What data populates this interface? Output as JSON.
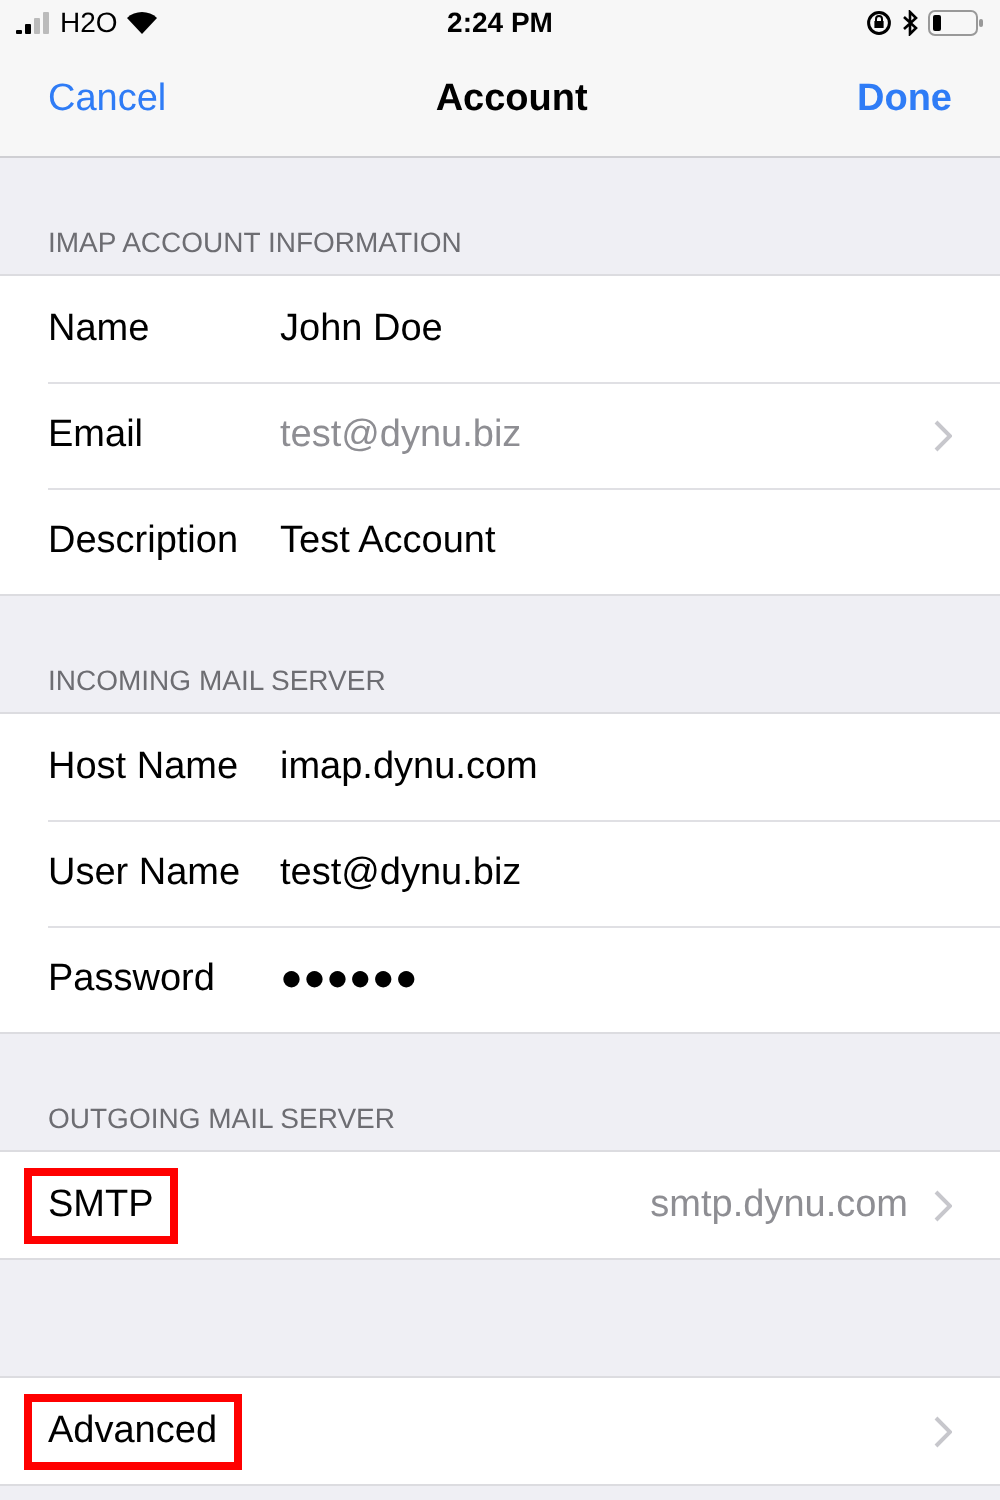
{
  "status_bar": {
    "carrier": "H2O",
    "time": "2:24 PM"
  },
  "nav": {
    "left": "Cancel",
    "title": "Account",
    "right": "Done"
  },
  "sections": [
    {
      "header": "IMAP ACCOUNT INFORMATION",
      "rows": [
        {
          "kind": "field",
          "label": "Name",
          "value": "John Doe",
          "muted": false,
          "chevron": false
        },
        {
          "kind": "field",
          "label": "Email",
          "value": "test@dynu.biz",
          "muted": true,
          "chevron": true
        },
        {
          "kind": "field",
          "label": "Description",
          "value": "Test Account",
          "muted": false,
          "chevron": false
        }
      ]
    },
    {
      "header": "INCOMING MAIL SERVER",
      "rows": [
        {
          "kind": "field",
          "label": "Host Name",
          "value": "imap.dynu.com",
          "muted": false,
          "chevron": false
        },
        {
          "kind": "field",
          "label": "User Name",
          "value": "test@dynu.biz",
          "muted": false,
          "chevron": false
        },
        {
          "kind": "field",
          "label": "Password",
          "value": "●●●●●●",
          "muted": false,
          "chevron": false
        }
      ]
    },
    {
      "header": "OUTGOING MAIL SERVER",
      "rows": [
        {
          "kind": "link",
          "label": "SMTP",
          "detail": "smtp.dynu.com",
          "highlighted": true
        }
      ]
    },
    {
      "rows": [
        {
          "kind": "link",
          "label": "Advanced",
          "highlighted": true
        }
      ]
    }
  ]
}
